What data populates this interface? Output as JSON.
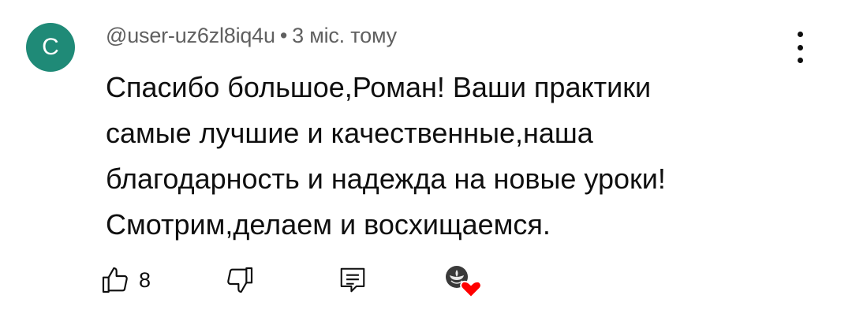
{
  "comment": {
    "avatar_letter": "C",
    "avatar_color": "#1f8a77",
    "author": "@user-uz6zl8iq4u",
    "separator": "•",
    "time": "3 міс. тому",
    "text_lines": [
      "Спасибо большое,Роман! Ваши практики",
      "самые лучшие и качественные,наша",
      "благодарность и надежда на новые уроки!",
      "Смотрим,делаем и восхищаемся."
    ],
    "likes": "8",
    "icons": {
      "more": "more-vertical-icon",
      "like": "thumb-up-icon",
      "dislike": "thumb-down-icon",
      "reply": "reply-icon",
      "heart": "creator-heart-icon"
    },
    "heart_color": "#ff0000"
  }
}
